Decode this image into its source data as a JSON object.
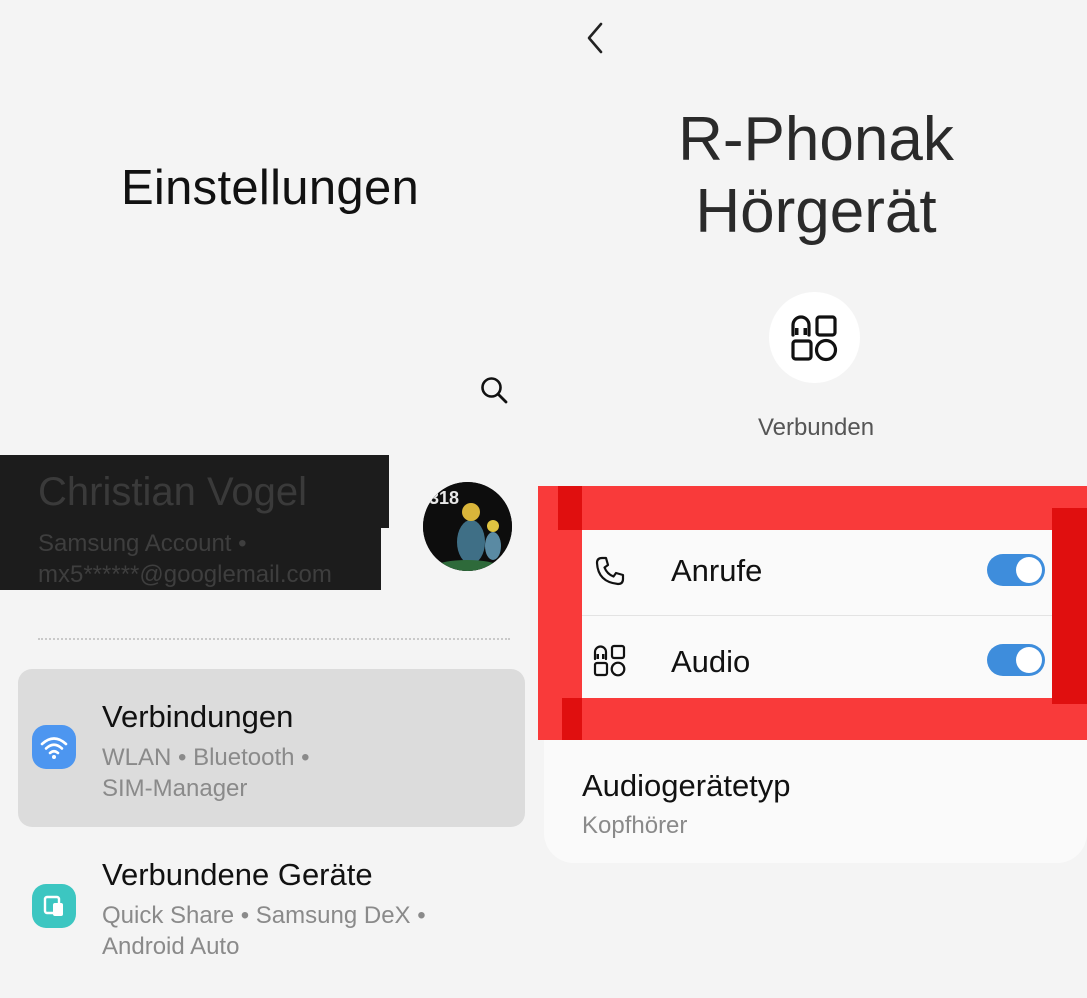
{
  "left": {
    "title": "Einstellungen",
    "profile": {
      "name": "Christian Vogel",
      "account_line": "Samsung Account  •",
      "email": "mx5******@googlemail.com",
      "avatar_text": "318"
    },
    "menu": [
      {
        "title": "Verbindungen",
        "sub_line1": "WLAN  •  Bluetooth  •",
        "sub_line2": "SIM-Manager",
        "icon": "wifi-icon",
        "color": "#4d96f0"
      },
      {
        "title": "Verbundene Geräte",
        "sub_line1": "Quick Share  •  Samsung DeX  •",
        "sub_line2": "Android Auto",
        "icon": "connected-devices-icon",
        "color": "#3cc6c1"
      }
    ]
  },
  "right": {
    "device_name_line1": "R-Phonak",
    "device_name_line2": "Hörgerät",
    "status": "Verbunden",
    "profiles": [
      {
        "label": "Anrufe",
        "icon": "phone-icon",
        "enabled": true
      },
      {
        "label": "Audio",
        "icon": "apps-icon",
        "enabled": true
      }
    ],
    "audio_device_type": {
      "title": "Audiogerätetyp",
      "value": "Kopfhörer"
    }
  },
  "colors": {
    "toggle_on": "#3e8ddc",
    "highlight_red": "#f93a3a",
    "background": "#f4f4f4"
  }
}
